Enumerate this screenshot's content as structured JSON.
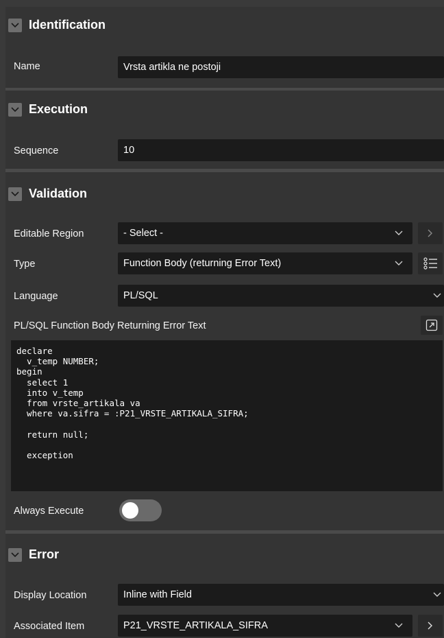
{
  "identification": {
    "title": "Identification",
    "name_label": "Name",
    "name_value": "Vrsta artikla ne postoji"
  },
  "execution": {
    "title": "Execution",
    "sequence_label": "Sequence",
    "sequence_value": "10"
  },
  "validation": {
    "title": "Validation",
    "editable_region_label": "Editable Region",
    "editable_region_value": "- Select -",
    "type_label": "Type",
    "type_value": "Function Body (returning Error Text)",
    "language_label": "Language",
    "language_value": "PL/SQL",
    "code_label": "PL/SQL Function Body Returning Error Text",
    "code_lines": [
      "declare",
      "  v_temp NUMBER;",
      "begin",
      "  select 1",
      "  into v_temp",
      "  from vrste_artikala va",
      "  where va.sifra = :P21_VRSTE_ARTIKALA_SIFRA;",
      "",
      "  return null;",
      "",
      "  exception"
    ],
    "always_execute_label": "Always Execute",
    "always_execute_on": false
  },
  "error": {
    "title": "Error",
    "display_location_label": "Display Location",
    "display_location_value": "Inline with Field",
    "associated_item_label": "Associated Item",
    "associated_item_value": "P21_VRSTE_ARTIKALA_SIFRA"
  },
  "colors": {
    "panel": "#343434",
    "field": "#1b1b1b",
    "chevron_box": "#6e6e6e"
  }
}
